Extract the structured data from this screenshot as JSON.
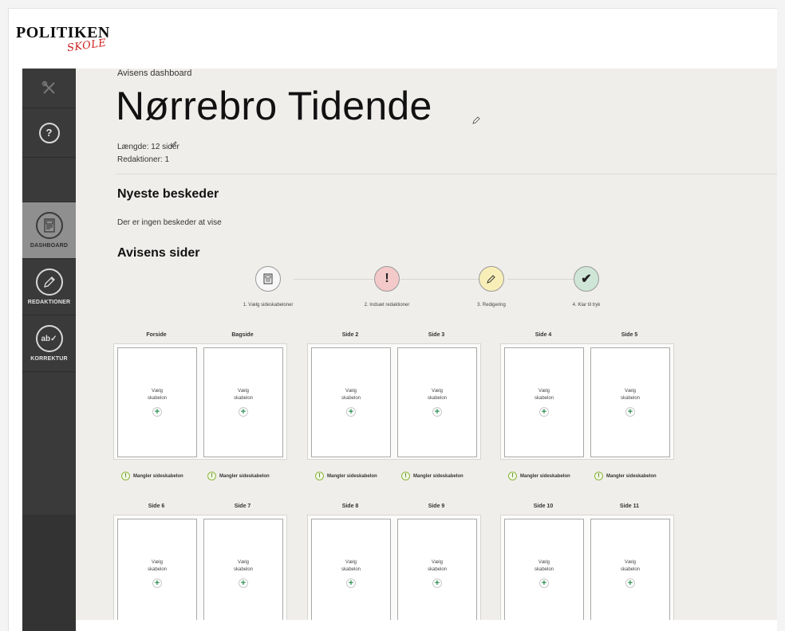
{
  "brand": {
    "name": "POLITIKEN",
    "sub": "SKOLE"
  },
  "sidebar": {
    "tools_icon": "tools-icon",
    "help_icon": "question-icon",
    "items": [
      {
        "label": "DASHBOARD",
        "icon": "newspaper-icon",
        "active": true
      },
      {
        "label": "REDAKTIONER",
        "icon": "pencil-icon",
        "active": false
      },
      {
        "label": "KORREKTUR",
        "icon": "spellcheck-icon",
        "active": false
      }
    ]
  },
  "dashboard": {
    "breadcrumb": "Avisens dashboard",
    "title": "Nørrebro Tidende",
    "length": "Længde: 12 sider",
    "editorials": "Redaktioner: 1",
    "messages_heading": "Nyeste beskeder",
    "no_messages": "Der er ingen beskeder at vise",
    "pages_heading": "Avisens sider"
  },
  "steps": [
    {
      "label": "1. Vælg sideskabeloner",
      "symbol": "",
      "color": "#f7f7f7"
    },
    {
      "label": "2. Indsæt redaktioner",
      "symbol": "!",
      "color": "#f4c9c9"
    },
    {
      "label": "3. Redigering",
      "symbol": "",
      "color": "#f8efb8"
    },
    {
      "label": "4. Klar til tryk",
      "symbol": "✔",
      "color": "#cfe6d6"
    }
  ],
  "page_template": {
    "choose_line1": "Vælg",
    "choose_line2": "skabelon",
    "plus": "+",
    "missing": "Mangler sideskabelon",
    "warn_symbol": "!"
  },
  "pages": [
    "Forside",
    "Bagside",
    "Side 2",
    "Side 3",
    "Side 4",
    "Side 5",
    "Side 6",
    "Side 7",
    "Side 8",
    "Side 9",
    "Side 10",
    "Side 11"
  ]
}
